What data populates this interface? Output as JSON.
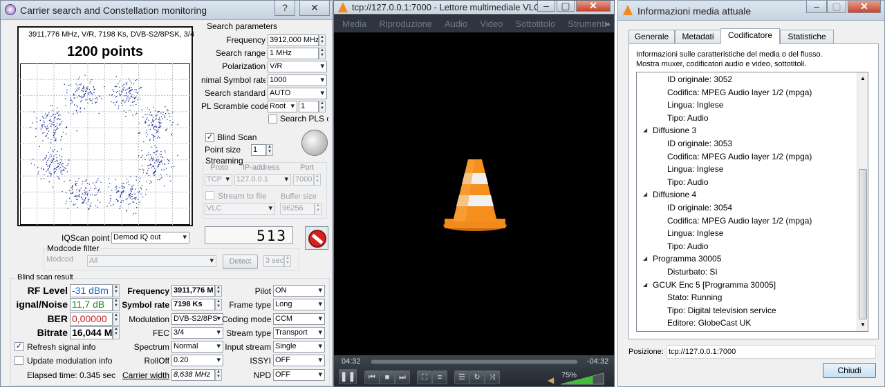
{
  "carrier": {
    "title": "Carrier search and Constellation monitoring",
    "help_btn": "?",
    "close_btn": "✕",
    "plot_header": "3911,776 MHz, V/R, 7198 Ks, DVB-S2/8PSK, 3/4",
    "points_label": "1200 points",
    "search_params_title": "Search parameters",
    "frequency_label": "Frequency",
    "frequency_value": "3912,000 MHz",
    "search_range_label": "Search range",
    "search_range_value": "1 MHz",
    "polarization_label": "Polarization",
    "polarization_value": "V/R",
    "min_symbol_label": "nimal Symbol rate",
    "min_symbol_value": "1000",
    "search_standard_label": "Search standard",
    "search_standard_value": "AUTO",
    "pl_scramble_label": "PL Scramble code",
    "pl_scramble_value": "Root",
    "pl_scramble_num": "1",
    "search_pls_label": "Search PLS cc",
    "blind_scan_label": "Blind Scan",
    "point_size_label": "Point size",
    "point_size_value": "1",
    "streaming_title": "Streaming",
    "proto_label": "Proto",
    "ip_label": "IP-address",
    "port_label": "Port",
    "proto_value": "TCP",
    "ip_value": "127.0.0.1",
    "port_value": "7000",
    "stream_file_label": "Stream to file",
    "buffer_label": "Buffer size",
    "player_value": "VLC",
    "buffer_value": "96256",
    "counter_value": "513",
    "iqscan_label": "IQScan point",
    "iqscan_value": "Demod IQ out",
    "modcode_filter_title": "Modcode filter",
    "modcode_label": "Modcod",
    "modcode_value": "All",
    "detect_btn": "Detect",
    "detect_time": "3 sec",
    "blind_result_title": "Blind scan result",
    "rf_level_label": "RF Level",
    "rf_level_value": "-31 dBm",
    "snr_label": "ignal/Noise",
    "snr_value": "11,7 dB",
    "ber_label": "BER",
    "ber_value": "0,00000",
    "bitrate_label": "Bitrate",
    "bitrate_value": "16,044 M",
    "res_frequency_label": "Frequency",
    "res_frequency_value": "3911,776 M",
    "symbol_rate_label": "Symbol rate",
    "symbol_rate_value": "7198 Ks",
    "modulation_label": "Modulation",
    "modulation_value": "DVB-S2/8PS",
    "fec_label": "FEC",
    "fec_value": "3/4",
    "spectrum_label": "Spectrum",
    "spectrum_value": "Normal",
    "rolloff_label": "RollOff",
    "rolloff_value": "0.20",
    "carrier_width_label": "Carrier width",
    "carrier_width_value": "8,638 MHz",
    "pilot_label": "Pilot",
    "pilot_value": "ON",
    "frame_type_label": "Frame type",
    "frame_type_value": "Long",
    "coding_mode_label": "Coding mode",
    "coding_mode_value": "CCM",
    "stream_type_label": "Stream type",
    "stream_type_value": "Transport",
    "input_stream_label": "Input stream",
    "input_stream_value": "Single",
    "issyi_label": "ISSYI",
    "issyi_value": "OFF",
    "npd_label": "NPD",
    "npd_value": "OFF",
    "refresh_label": "Refresh signal info",
    "update_mod_label": "Update modulation info",
    "elapsed_label": "Elapsed time: 0.345 sec"
  },
  "vlc": {
    "title": "tcp://127.0.0.1:7000 - Lettore multimediale VLC",
    "menu": [
      "Media",
      "Riproduzione",
      "Audio",
      "Video",
      "Sottotitolo",
      "Strumenti"
    ],
    "menu_more": "»",
    "time_elapsed": "04:32",
    "time_remaining": "-04:32",
    "volume": "75%",
    "volume_level": 0.75,
    "colors": {
      "cone_orange": "#f28a1c",
      "volume_green": "#3fbf3a"
    }
  },
  "info": {
    "title": "Informazioni media attuale",
    "tabs": [
      "Generale",
      "Metadati",
      "Codificatore",
      "Statistiche"
    ],
    "desc_line1": "Informazioni sulle caratteristiche del media o del flusso.",
    "desc_line2": "Mostra muxer, codificatori audio e video, sottotitoli.",
    "tree": [
      {
        "text": "ID originale: 3052",
        "level": 2
      },
      {
        "text": "Codifica: MPEG Audio layer 1/2 (mpga)",
        "level": 2
      },
      {
        "text": "Lingua: Inglese",
        "level": 2
      },
      {
        "text": "Tipo: Audio",
        "level": 2
      },
      {
        "text": "Diffusione 3",
        "level": 1
      },
      {
        "text": "ID originale: 3053",
        "level": 2
      },
      {
        "text": "Codifica: MPEG Audio layer 1/2 (mpga)",
        "level": 2
      },
      {
        "text": "Lingua: Inglese",
        "level": 2
      },
      {
        "text": "Tipo: Audio",
        "level": 2
      },
      {
        "text": "Diffusione 4",
        "level": 1
      },
      {
        "text": "ID originale: 3054",
        "level": 2
      },
      {
        "text": "Codifica: MPEG Audio layer 1/2 (mpga)",
        "level": 2
      },
      {
        "text": "Lingua: Inglese",
        "level": 2
      },
      {
        "text": "Tipo: Audio",
        "level": 2
      },
      {
        "text": "Programma 30005",
        "level": 1
      },
      {
        "text": "Disturbato: Sì",
        "level": 2
      },
      {
        "text": "GCUK Enc 5 [Programma 30005]",
        "level": 1
      },
      {
        "text": "Stato: Running",
        "level": 2
      },
      {
        "text": "Tipo: Digital television service",
        "level": 2
      },
      {
        "text": "Editore: GlobeCast UK",
        "level": 2
      }
    ],
    "position_label": "Posizione:",
    "position_value": "tcp://127.0.0.1:7000",
    "close_btn": "Chiudi"
  }
}
